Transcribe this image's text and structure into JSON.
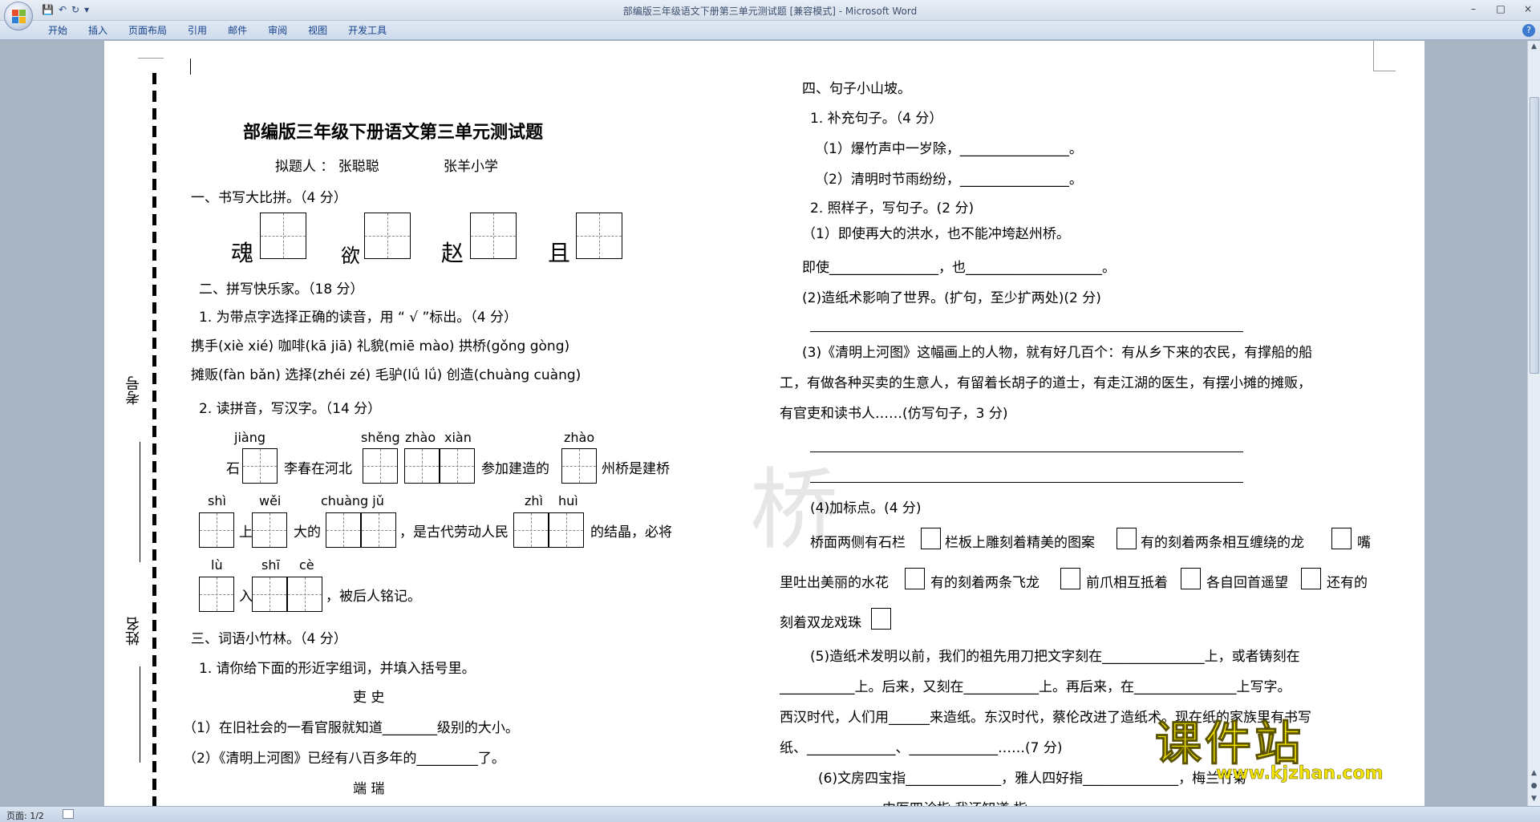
{
  "window": {
    "title": "部编版三年级语文下册第三单元测试题 [兼容模式] - Microsoft Word",
    "controls": [
      "–",
      "□",
      "×"
    ]
  },
  "ribbon": {
    "tabs": [
      "开始",
      "插入",
      "页面布局",
      "引用",
      "邮件",
      "审阅",
      "视图",
      "开发工具"
    ]
  },
  "status": {
    "page": "页面: 1/2"
  },
  "doc": {
    "title": "部编版三年级下册语文第三单元测试题",
    "author_line": "拟题人 ： 张聪聪",
    "school": "张羊小学",
    "side_kaohao": "考号",
    "side_xingming": "姓名",
    "s1_heading": "一、书写大比拼。（4 分）",
    "s1_chars": [
      "魂",
      "欲",
      "赵",
      "且"
    ],
    "s2_heading": "二、拼写快乐家。（18 分）",
    "s2_q1": "1. 为带点字选择正确的读音，用 “ √ ”标出。（4 分）",
    "s2_pinyin_row1": "携手(xiè xié) 咖啡(kā    jiā) 礼貌(miē  mào)   拱桥(gǒng    gòng)",
    "s2_pinyin_row2": "摊贩(fàn bǎn) 选择(zhéi   zé) 毛驴(lǘ     lǘ)   创造(chuàng  cuàng)",
    "s2_q2": "2. 读拼音，写汉字。（14 分）",
    "py": {
      "jiang": "jiàng",
      "sheng": "shěng",
      "zhao": "zhào",
      "xian": "xiàn",
      "zhao2": "zhào",
      "shi": "shì",
      "wei": "wěi",
      "chuangju": "chuàng  jǔ",
      "zhi": "zhì",
      "hui": "huì",
      "lu": "lù",
      "shi2": "shī",
      "ce": "cè"
    },
    "line1": {
      "a": "石",
      "b": "李春在河北",
      "c": "参加建造的",
      "d": "州桥是建桥"
    },
    "line2": {
      "a": "上",
      "b": "大的",
      "c": "，是古代劳动人民",
      "d": "的结晶，必将"
    },
    "line3": {
      "a": "入",
      "b": "，被后人铭记。"
    },
    "s3_heading": "三、词语小竹林。（4 分）",
    "s3_q1": "1. 请你给下面的形近字组词，并填入括号里。",
    "s3_pair1": "吏     史",
    "s3_item1": "（1）在旧社会的一看官服就知道________级别的大小。",
    "s3_item2": "（2）《清明上河图》已经有八百多年的_________了。",
    "s3_pair2": "端     瑞",
    "s4_heading": "四、句子小山坡。",
    "s4_q1": "1. 补充句子。（4 分）",
    "s4_q1_1": "（1）爆竹声中一岁除，________________。",
    "s4_q1_2": "（2）清明时节雨纷纷，________________。",
    "s4_q2": "2. 照样子，写句子。(2 分)",
    "s4_q2_ex": "（1）即使再大的洪水，也不能冲垮赵州桥。",
    "s4_q2_blank": "即使________________，也____________________。",
    "s4_q2_2": "(2)造纸术影响了世界。(扩句，至少扩两处)(2 分)",
    "s4_q3_l1": "(3)《清明上河图》这幅画上的人物，就有好几百个：有从乡下来的农民，有撑船的船",
    "s4_q3_l2": "工，有做各种买卖的生意人，有留着长胡子的道士，有走江湖的医生，有摆小摊的摊贩，",
    "s4_q3_l3": "有官吏和读书人……(仿写句子，3 分)",
    "s4_q4": "(4)加标点。(4 分)",
    "s4_q4_a": "桥面两侧有石栏",
    "s4_q4_b": "栏板上雕刻着精美的图案",
    "s4_q4_c": "有的刻着两条相互缠绕的龙",
    "s4_q4_d": "嘴",
    "s4_q4_e": "里吐出美丽的水花",
    "s4_q4_f": "有的刻着两条飞龙",
    "s4_q4_g": "前爪相互抵着",
    "s4_q4_h": "各自回首遥望",
    "s4_q4_i": "还有的",
    "s4_q4_j": "刻着双龙戏珠",
    "s4_q5_l1": "(5)造纸术发明以前，我们的祖先用刀把文字刻在_______________上，或者铸刻在",
    "s4_q5_l2": "___________上。后来，又刻在___________上。再后来，在_______________上写字。",
    "s4_q5_l3": "西汉时代，人们用______来造纸。东汉时代，蔡伦改进了造纸术。现在纸的家族里有书写",
    "s4_q5_l4": "纸、_____________、_____________……(7 分)",
    "s4_q6": "(6)文房四宝指______________，雅人四好指______________，梅兰竹菊",
    "s4_q6_cut": "中医四诊指           我还知道            指"
  },
  "watermark": {
    "text": "课件站",
    "url": "www.kjzhan.com"
  }
}
